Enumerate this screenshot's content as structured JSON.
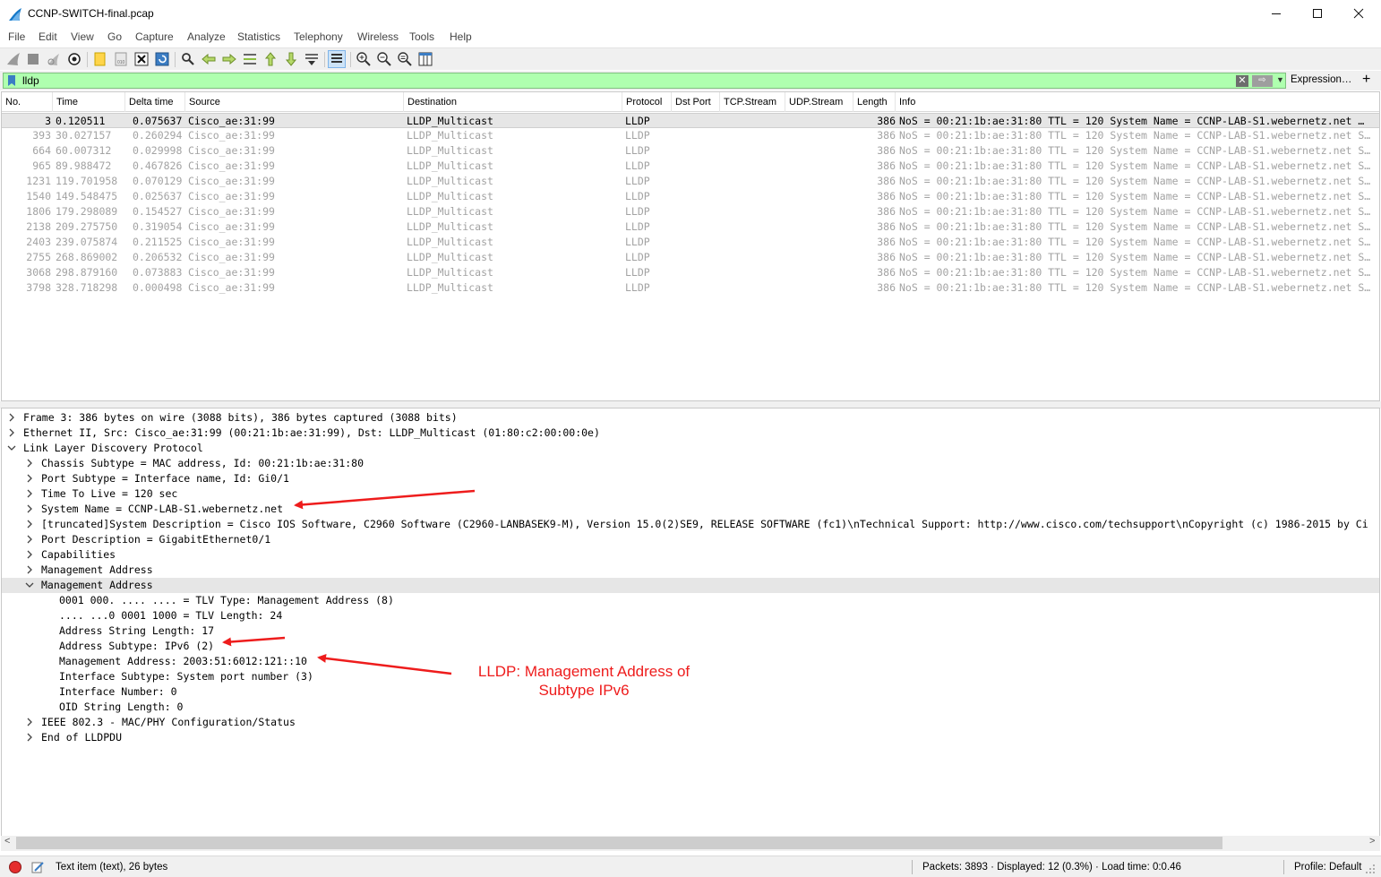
{
  "window": {
    "title": "CCNP-SWITCH-final.pcap"
  },
  "menu": [
    "File",
    "Edit",
    "View",
    "Go",
    "Capture",
    "Analyze",
    "Statistics",
    "Telephony",
    "Wireless",
    "Tools",
    "Help"
  ],
  "filter": {
    "value": "lldp",
    "expression_label": "Expression…",
    "add_label": "+"
  },
  "packet_list": {
    "columns": [
      "No.",
      "Time",
      "Delta time",
      "Source",
      "Destination",
      "Protocol",
      "Dst Port",
      "TCP.Stream",
      "UDP.Stream",
      "Length",
      "Info"
    ],
    "rows": [
      {
        "no": "3",
        "time": "0.120511",
        "delta": "0.075637",
        "source": "Cisco_ae:31:99",
        "destination": "LLDP_Multicast",
        "protocol": "LLDP",
        "length": "386",
        "info": "NoS = 00:21:1b:ae:31:80 TTL = 120 System Name = CCNP-LAB-S1.webernetz.net …"
      },
      {
        "no": "393",
        "time": "30.027157",
        "delta": "0.260294",
        "source": "Cisco_ae:31:99",
        "destination": "LLDP_Multicast",
        "protocol": "LLDP",
        "length": "386",
        "info": "NoS = 00:21:1b:ae:31:80 TTL = 120 System Name = CCNP-LAB-S1.webernetz.net S…"
      },
      {
        "no": "664",
        "time": "60.007312",
        "delta": "0.029998",
        "source": "Cisco_ae:31:99",
        "destination": "LLDP_Multicast",
        "protocol": "LLDP",
        "length": "386",
        "info": "NoS = 00:21:1b:ae:31:80 TTL = 120 System Name = CCNP-LAB-S1.webernetz.net S…"
      },
      {
        "no": "965",
        "time": "89.988472",
        "delta": "0.467826",
        "source": "Cisco_ae:31:99",
        "destination": "LLDP_Multicast",
        "protocol": "LLDP",
        "length": "386",
        "info": "NoS = 00:21:1b:ae:31:80 TTL = 120 System Name = CCNP-LAB-S1.webernetz.net S…"
      },
      {
        "no": "1231",
        "time": "119.701958",
        "delta": "0.070129",
        "source": "Cisco_ae:31:99",
        "destination": "LLDP_Multicast",
        "protocol": "LLDP",
        "length": "386",
        "info": "NoS = 00:21:1b:ae:31:80 TTL = 120 System Name = CCNP-LAB-S1.webernetz.net S…"
      },
      {
        "no": "1540",
        "time": "149.548475",
        "delta": "0.025637",
        "source": "Cisco_ae:31:99",
        "destination": "LLDP_Multicast",
        "protocol": "LLDP",
        "length": "386",
        "info": "NoS = 00:21:1b:ae:31:80 TTL = 120 System Name = CCNP-LAB-S1.webernetz.net S…"
      },
      {
        "no": "1806",
        "time": "179.298089",
        "delta": "0.154527",
        "source": "Cisco_ae:31:99",
        "destination": "LLDP_Multicast",
        "protocol": "LLDP",
        "length": "386",
        "info": "NoS = 00:21:1b:ae:31:80 TTL = 120 System Name = CCNP-LAB-S1.webernetz.net S…"
      },
      {
        "no": "2138",
        "time": "209.275750",
        "delta": "0.319054",
        "source": "Cisco_ae:31:99",
        "destination": "LLDP_Multicast",
        "protocol": "LLDP",
        "length": "386",
        "info": "NoS = 00:21:1b:ae:31:80 TTL = 120 System Name = CCNP-LAB-S1.webernetz.net S…"
      },
      {
        "no": "2403",
        "time": "239.075874",
        "delta": "0.211525",
        "source": "Cisco_ae:31:99",
        "destination": "LLDP_Multicast",
        "protocol": "LLDP",
        "length": "386",
        "info": "NoS = 00:21:1b:ae:31:80 TTL = 120 System Name = CCNP-LAB-S1.webernetz.net S…"
      },
      {
        "no": "2755",
        "time": "268.869002",
        "delta": "0.206532",
        "source": "Cisco_ae:31:99",
        "destination": "LLDP_Multicast",
        "protocol": "LLDP",
        "length": "386",
        "info": "NoS = 00:21:1b:ae:31:80 TTL = 120 System Name = CCNP-LAB-S1.webernetz.net S…"
      },
      {
        "no": "3068",
        "time": "298.879160",
        "delta": "0.073883",
        "source": "Cisco_ae:31:99",
        "destination": "LLDP_Multicast",
        "protocol": "LLDP",
        "length": "386",
        "info": "NoS = 00:21:1b:ae:31:80 TTL = 120 System Name = CCNP-LAB-S1.webernetz.net S…"
      },
      {
        "no": "3798",
        "time": "328.718298",
        "delta": "0.000498",
        "source": "Cisco_ae:31:99",
        "destination": "LLDP_Multicast",
        "protocol": "LLDP",
        "length": "386",
        "info": "NoS = 00:21:1b:ae:31:80 TTL = 120 System Name = CCNP-LAB-S1.webernetz.net S…"
      }
    ]
  },
  "details": {
    "lines": [
      {
        "level": 0,
        "arrow": "collapsed",
        "text": "Frame 3: 386 bytes on wire (3088 bits), 386 bytes captured (3088 bits)"
      },
      {
        "level": 0,
        "arrow": "collapsed",
        "text": "Ethernet II, Src: Cisco_ae:31:99 (00:21:1b:ae:31:99), Dst: LLDP_Multicast (01:80:c2:00:00:0e)"
      },
      {
        "level": 0,
        "arrow": "expanded",
        "text": "Link Layer Discovery Protocol"
      },
      {
        "level": 1,
        "arrow": "collapsed",
        "text": "Chassis Subtype = MAC address, Id: 00:21:1b:ae:31:80"
      },
      {
        "level": 1,
        "arrow": "collapsed",
        "text": "Port Subtype = Interface name, Id: Gi0/1"
      },
      {
        "level": 1,
        "arrow": "collapsed",
        "text": "Time To Live = 120 sec"
      },
      {
        "level": 1,
        "arrow": "collapsed",
        "text": "System Name = CCNP-LAB-S1.webernetz.net"
      },
      {
        "level": 1,
        "arrow": "collapsed",
        "text": " [truncated]System Description = Cisco IOS Software, C2960 Software (C2960-LANBASEK9-M), Version 15.0(2)SE9, RELEASE SOFTWARE (fc1)\\nTechnical Support: http://www.cisco.com/techsupport\\nCopyright (c) 1986-2015 by Ci"
      },
      {
        "level": 1,
        "arrow": "collapsed",
        "text": "Port Description = GigabitEthernet0/1"
      },
      {
        "level": 1,
        "arrow": "collapsed",
        "text": "Capabilities"
      },
      {
        "level": 1,
        "arrow": "collapsed",
        "text": "Management Address"
      },
      {
        "level": 1,
        "arrow": "expanded",
        "text": "Management Address",
        "selected": true
      },
      {
        "level": 2,
        "arrow": "none",
        "text": "0001 000. .... .... = TLV Type: Management Address (8)"
      },
      {
        "level": 2,
        "arrow": "none",
        "text": ".... ...0 0001 1000 = TLV Length: 24"
      },
      {
        "level": 2,
        "arrow": "none",
        "text": "Address String Length: 17"
      },
      {
        "level": 2,
        "arrow": "none",
        "text": "Address Subtype: IPv6 (2)"
      },
      {
        "level": 2,
        "arrow": "none",
        "text": "Management Address: 2003:51:6012:121::10"
      },
      {
        "level": 2,
        "arrow": "none",
        "text": "Interface Subtype: System port number (3)"
      },
      {
        "level": 2,
        "arrow": "none",
        "text": "Interface Number: 0"
      },
      {
        "level": 2,
        "arrow": "none",
        "text": "OID String Length: 0"
      },
      {
        "level": 1,
        "arrow": "collapsed",
        "text": "IEEE 802.3 - MAC/PHY Configuration/Status"
      },
      {
        "level": 1,
        "arrow": "collapsed",
        "text": "End of LLDPDU"
      }
    ]
  },
  "annotation": {
    "line1": "LLDP: Management Address of",
    "line2": "Subtype IPv6",
    "color": "#ee1c1c"
  },
  "status": {
    "text": "Text item (text), 26 bytes",
    "packets": "Packets: 3893 · Displayed: 12 (0.3%) · Load time: 0:0.46",
    "profile": "Profile: Default"
  },
  "colors": {
    "filter_bg": "#afffaf",
    "selected_row": "#e6e6e6",
    "dim_text": "#a3a3a3"
  }
}
